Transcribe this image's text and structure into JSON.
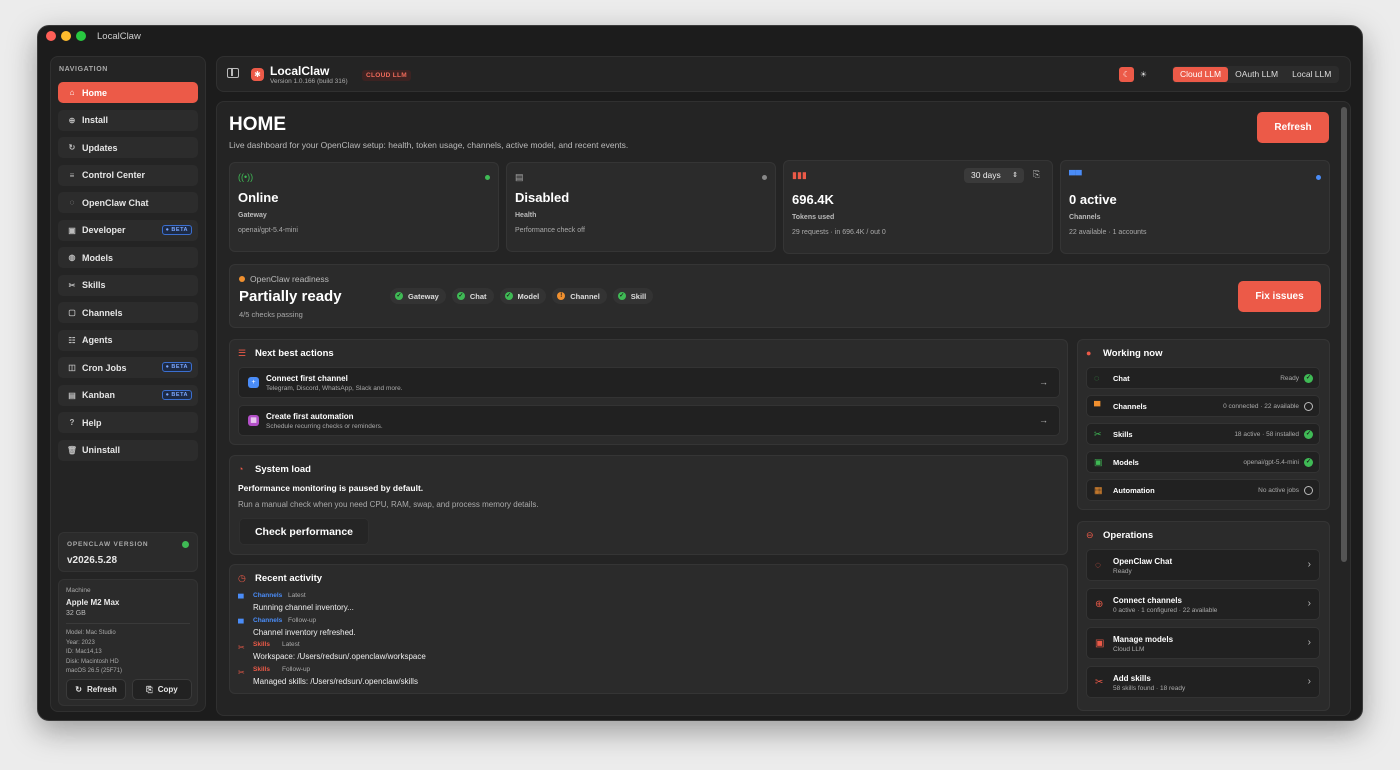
{
  "window": {
    "title": "LocalClaw"
  },
  "sidebar": {
    "section_label": "NAVIGATION",
    "items": [
      {
        "label": "Home",
        "icon": "home-icon",
        "glyph": "⌂",
        "active": true,
        "beta": false
      },
      {
        "label": "Install",
        "icon": "install-icon",
        "glyph": "⊕",
        "active": false,
        "beta": false
      },
      {
        "label": "Updates",
        "icon": "updates-icon",
        "glyph": "↻",
        "active": false,
        "beta": false
      },
      {
        "label": "Control Center",
        "icon": "control-center-icon",
        "glyph": "≡",
        "active": false,
        "beta": false
      },
      {
        "label": "OpenClaw Chat",
        "icon": "chat-icon",
        "glyph": "◌",
        "active": false,
        "beta": false
      },
      {
        "label": "Developer",
        "icon": "developer-icon",
        "glyph": "▣",
        "active": false,
        "beta": true
      },
      {
        "label": "Models",
        "icon": "models-icon",
        "glyph": "◍",
        "active": false,
        "beta": false
      },
      {
        "label": "Skills",
        "icon": "skills-icon",
        "glyph": "✂",
        "active": false,
        "beta": false
      },
      {
        "label": "Channels",
        "icon": "channels-icon",
        "glyph": "▢",
        "active": false,
        "beta": false
      },
      {
        "label": "Agents",
        "icon": "agents-icon",
        "glyph": "☷",
        "active": false,
        "beta": false
      },
      {
        "label": "Cron Jobs",
        "icon": "cron-jobs-icon",
        "glyph": "◫",
        "active": false,
        "beta": true
      },
      {
        "label": "Kanban",
        "icon": "kanban-icon",
        "glyph": "▤",
        "active": false,
        "beta": true
      },
      {
        "label": "Help",
        "icon": "help-icon",
        "glyph": "?",
        "active": false,
        "beta": false
      },
      {
        "label": "Uninstall",
        "icon": "trash-icon",
        "glyph": "🗑",
        "active": false,
        "beta": false
      }
    ],
    "beta_label": "● BETA",
    "version": {
      "label": "OPENCLAW VERSION",
      "value": "v2026.5.28"
    },
    "machine": {
      "label": "Machine",
      "name": "Apple M2 Max",
      "ram": "32 GB",
      "model": "Model: Mac Studio",
      "year": "Year: 2023",
      "id": "ID: Mac14,13",
      "disk": "Disk: Macintosh HD",
      "os": "macOS 26.5 (25F71)",
      "refresh_label": "Refresh",
      "copy_label": "Copy"
    }
  },
  "topbar": {
    "app_name": "LocalClaw",
    "version": "Version 1.0.166 (build 316)",
    "badge": "CLOUD LLM",
    "modes": [
      "Cloud LLM",
      "OAuth LLM",
      "Local LLM"
    ],
    "active_mode": "Cloud LLM"
  },
  "home": {
    "title": "HOME",
    "subtitle": "Live dashboard for your OpenClaw setup: health, token usage, channels, active model, and recent events.",
    "refresh_label": "Refresh",
    "stats": {
      "gateway": {
        "value": "Online",
        "label": "Gateway",
        "detail": "openai/gpt-5.4-mini"
      },
      "health": {
        "value": "Disabled",
        "label": "Health",
        "detail": "Performance check off"
      },
      "tokens": {
        "value": "696.4K",
        "label": "Tokens used",
        "detail": "29 requests · in 696.4K / out 0",
        "range": "30 days"
      },
      "channels": {
        "value": "0 active",
        "label": "Channels",
        "detail": "22 available · 1 accounts"
      }
    },
    "readiness": {
      "tag": "OpenClaw readiness",
      "title": "Partially ready",
      "sub": "4/5 checks passing",
      "checks": [
        {
          "label": "Gateway",
          "status": "ok"
        },
        {
          "label": "Chat",
          "status": "ok"
        },
        {
          "label": "Model",
          "status": "ok"
        },
        {
          "label": "Channel",
          "status": "warn"
        },
        {
          "label": "Skill",
          "status": "ok"
        }
      ],
      "fix_label": "Fix issues"
    },
    "next_actions": {
      "title": "Next best actions",
      "items": [
        {
          "title": "Connect first channel",
          "desc": "Telegram, Discord, WhatsApp, Slack and more."
        },
        {
          "title": "Create first automation",
          "desc": "Schedule recurring checks or reminders."
        }
      ]
    },
    "system_load": {
      "title": "System load",
      "bold": "Performance monitoring is paused by default.",
      "text": "Run a manual check when you need CPU, RAM, swap, and process memory details.",
      "button": "Check performance"
    },
    "recent_activity": {
      "title": "Recent activity",
      "events": [
        {
          "category": "Channels",
          "tag": "Latest",
          "message": "Running channel inventory..."
        },
        {
          "category": "Channels",
          "tag": "Follow-up",
          "message": "Channel inventory refreshed."
        },
        {
          "category": "Skills",
          "tag": "Latest",
          "message": "Workspace: /Users/redsun/.openclaw/workspace"
        },
        {
          "category": "Skills",
          "tag": "Follow-up",
          "message": "Managed skills: /Users/redsun/.openclaw/skills"
        }
      ]
    },
    "working_now": {
      "title": "Working now",
      "items": [
        {
          "name": "Chat",
          "status": "Ready",
          "ok": true
        },
        {
          "name": "Channels",
          "status": "0 connected · 22 available",
          "ok": false
        },
        {
          "name": "Skills",
          "status": "18 active · 58 installed",
          "ok": true
        },
        {
          "name": "Models",
          "status": "openai/gpt-5.4-mini",
          "ok": true
        },
        {
          "name": "Automation",
          "status": "No active jobs",
          "ok": false
        }
      ]
    },
    "operations": {
      "title": "Operations",
      "items": [
        {
          "name": "OpenClaw Chat",
          "sub": "Ready"
        },
        {
          "name": "Connect channels",
          "sub": "0 active · 1 configured · 22 available"
        },
        {
          "name": "Manage models",
          "sub": "Cloud LLM"
        },
        {
          "name": "Add skills",
          "sub": "58 skills found · 18 ready"
        }
      ]
    }
  },
  "colors": {
    "accent": "#ec5a48",
    "ok": "#3fba55",
    "warn": "#f0902f",
    "info": "#4a8cf7"
  }
}
